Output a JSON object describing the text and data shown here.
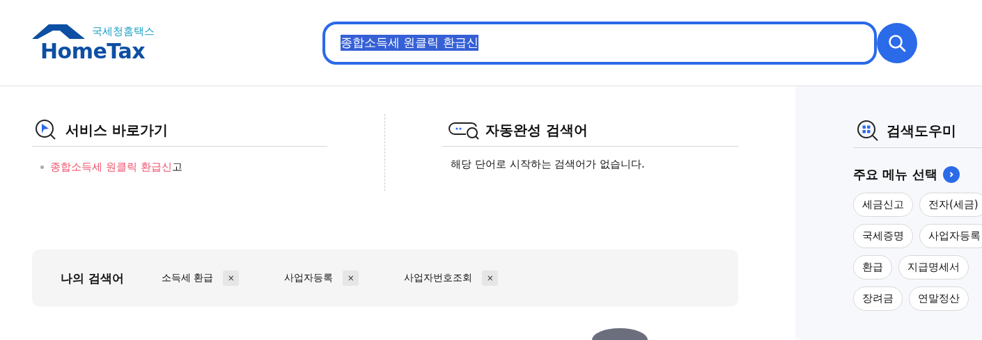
{
  "header": {
    "logo": {
      "subtitle": "국세청홈택스",
      "name": "HomeTax"
    },
    "search": {
      "value": "종합소득세 원클릭 환급신",
      "text_selected": true
    }
  },
  "service_shortcuts": {
    "title": "서비스 바로가기",
    "items": [
      {
        "match": "종합소득세 원클릭 환급신",
        "rest": "고"
      }
    ]
  },
  "autocomplete": {
    "title": "자동완성 검색어",
    "message": "해당 단어로 시작하는 검색어가 없습니다."
  },
  "my_searches": {
    "label": "나의 검색어",
    "items": [
      {
        "text": "소득세 환급",
        "remove": "×"
      },
      {
        "text": "사업자등록",
        "remove": "×"
      },
      {
        "text": "사업자번호조회",
        "remove": "×"
      }
    ]
  },
  "search_helper": {
    "title": "검색도우미",
    "menu_title": "주요 메뉴 선택",
    "rows": [
      [
        "세금신고",
        "전자(세금)"
      ],
      [
        "국세증명",
        "사업자등록"
      ],
      [
        "환급",
        "지급명세서"
      ],
      [
        "장려금",
        "연말정산"
      ]
    ]
  }
}
